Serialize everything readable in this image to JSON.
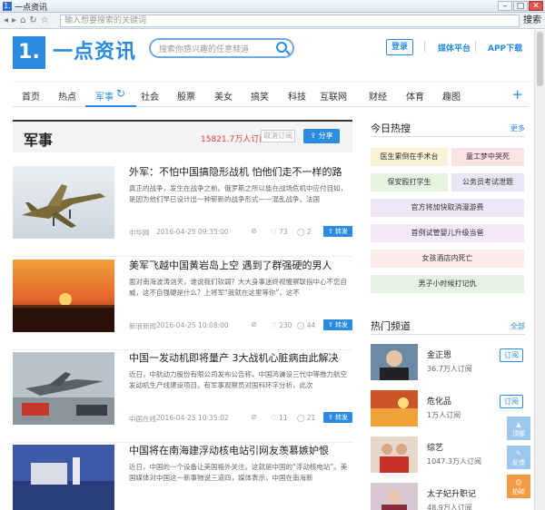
{
  "window": {
    "title": "一点资讯",
    "app_icon": "1.",
    "min": "–",
    "max": "□",
    "close": "✕"
  },
  "addressbar": {
    "placeholder": "输入想要搜索的关键词",
    "search_label": "搜索",
    "back": "◂",
    "forward": "▸",
    "home": "⌂",
    "refresh": "↻",
    "lock": "☆"
  },
  "header": {
    "logo_mark": "1.",
    "logo_text": "一点资讯",
    "search_placeholder": "搜索你感兴趣的任意频道",
    "login": "登录",
    "media_platform": "媒体平台",
    "app_download": "APP下载"
  },
  "nav": {
    "items": [
      "首页",
      "热点",
      "军事",
      "社会",
      "股票",
      "美女",
      "搞笑",
      "科技",
      "互联网",
      "财经",
      "体育",
      "趣图"
    ],
    "active_index": 2,
    "refresh_icon": "↻",
    "add": "+"
  },
  "channel": {
    "title": "军事",
    "followers": "15821.7万人订阅",
    "unsubscribe": "取消订阅",
    "share": "分享"
  },
  "articles": [
    {
      "title": "外军：不怕中国搞隐形战机 怕他们走不一样的路",
      "summary": "真正的战争，发生在战争之前。俄罗斯之所以能在战场危机中应付目如，是因为他们早已设计出一种崭新的战争形式——混乱战争。法国",
      "source": "中华网",
      "date": "2016-04-25 09:35:00",
      "likes": "73",
      "comments": "2",
      "forward": "转发"
    },
    {
      "title": "美军飞越中国黄岩岛上空 遇到了群强硬的男人",
      "summary": "面对南海波涛汹天，谁说我们软弱？大大身事迷终视慢察联指中心不您自威，这不自强硬是什么？上将军“我就在这里等你”，这不",
      "source": "新浪新闻",
      "date": "2016-04-25 10:08:00",
      "likes": "230",
      "comments": "44",
      "forward": "转发"
    },
    {
      "title": "中国一发动机即将量产 3大战机心脏病由此解决",
      "summary": "近日，中航动力股份有限公司发布公告称，中国鸿谦设三代中等推力航空发动机生产线建设项目。有军事观察员对国科环字分析，此次",
      "source": "中国在线",
      "date": "2016-04-25 10:35:02",
      "likes": "11",
      "comments": "21",
      "forward": "转发"
    },
    {
      "title": "中国将在南海建浮动核电站引网友羡慕嫉妒恨",
      "summary": "近日，中国的一个设备让美国格外关注。这就是中国的“浮动核电站”。美国媒体对中国这一新事物说三道四，媒体表示，中国在南海新",
      "source": "",
      "date": "",
      "likes": "",
      "comments": "",
      "forward": ""
    }
  ],
  "right": {
    "hot_title": "今日热搜",
    "hot_more": "更多",
    "hot_tags": [
      "医生累倒在手术台",
      "童工梦中哭死",
      "保安殴打学生",
      "公务员考试泄题",
      "官方将加快取消漫游费",
      "首例试管婴儿升级当爸",
      "女孩酒店内死亡",
      "男子小时候打记仇"
    ],
    "channels_title": "热门频道",
    "channels_all": "全部",
    "channels": [
      {
        "name": "金正恩",
        "subs": "36.7万人订阅",
        "btn": "订阅"
      },
      {
        "name": "危化品",
        "subs": "1万人订阅",
        "btn": "订阅"
      },
      {
        "name": "综艺",
        "subs": "1047.3万人订阅",
        "btn": "订阅"
      },
      {
        "name": "太子妃升职记",
        "subs": "48.9万人订阅",
        "btn": "订阅"
      }
    ]
  },
  "floating": {
    "top": "顶部",
    "feedback": "反馈",
    "tips": "拍砖"
  },
  "colors": {
    "accent": "#2a8be0",
    "followers": "#e03b3b"
  }
}
